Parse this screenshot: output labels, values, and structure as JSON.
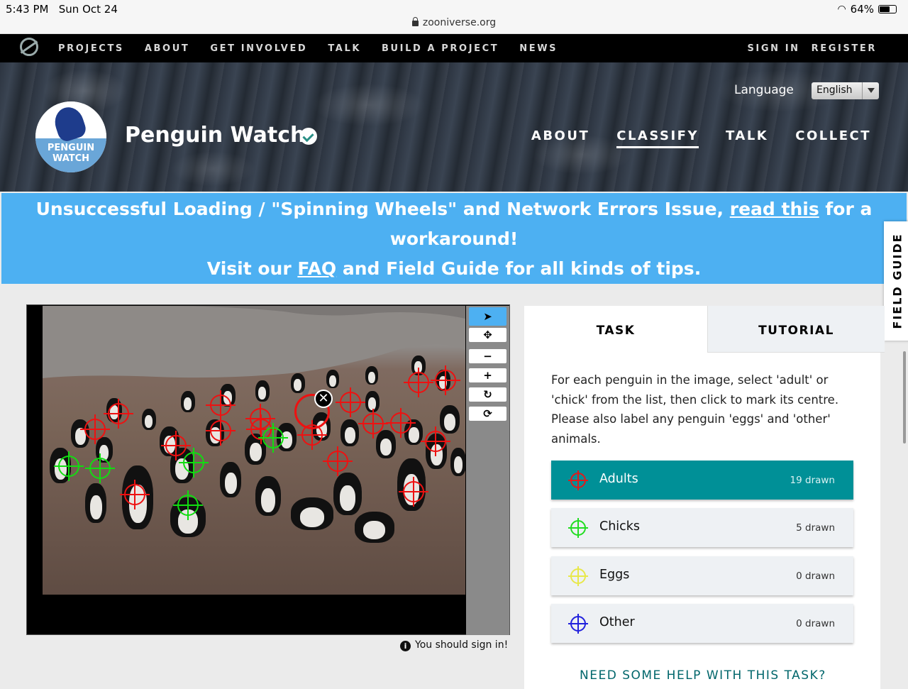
{
  "status_bar": {
    "time": "5:43 PM",
    "date": "Sun Oct 24",
    "url": "zooniverse.org",
    "battery": "64%"
  },
  "zoo_nav": {
    "items": [
      "PROJECTS",
      "ABOUT",
      "GET INVOLVED",
      "TALK",
      "BUILD A PROJECT",
      "NEWS"
    ],
    "sign_in": "SIGN IN",
    "register": "REGISTER"
  },
  "project": {
    "avatar_text_1": "PENGUIN",
    "avatar_text_2": "WATCH",
    "title": "Penguin Watch",
    "language_label": "Language",
    "language_value": "English",
    "nav": [
      "ABOUT",
      "CLASSIFY",
      "TALK",
      "COLLECT"
    ],
    "active_nav": "CLASSIFY"
  },
  "announcement": {
    "line1_pre": "Unsuccessful Loading / \"Spinning Wheels\" and Network Errors Issue, ",
    "line1_link": "read this",
    "line1_post": " for a",
    "line2": "workaround!",
    "line3_pre": "Visit our ",
    "line3_link": "FAQ",
    "line3_post": " and Field Guide for all kinds of tips."
  },
  "field_guide": "FIELD GUIDE",
  "viewer": {
    "tools": [
      "pointer-icon",
      "move-icon",
      "zoom-out-icon",
      "zoom-in-icon",
      "rotate-icon",
      "reset-icon"
    ],
    "tool_glyphs": [
      "➤",
      "✥",
      "−",
      "+",
      "↻",
      "⟳"
    ],
    "delete_glyph": "✕",
    "sign_in_note": "You should sign in!",
    "info_glyph": "i"
  },
  "task": {
    "tabs": [
      "TASK",
      "TUTORIAL"
    ],
    "instructions": "For each penguin in the image, select 'adult' or 'chick' from the list, then click to mark its centre. Please also label any penguin 'eggs' and 'other' animals.",
    "choices": [
      {
        "label": "Adults",
        "count": "19 drawn",
        "color": "#e11b1b",
        "selected": true
      },
      {
        "label": "Chicks",
        "count": "5 drawn",
        "color": "#22dd22",
        "selected": false
      },
      {
        "label": "Eggs",
        "count": "0 drawn",
        "color": "#e8e84a",
        "selected": false
      },
      {
        "label": "Other",
        "count": "0 drawn",
        "color": "#2222dd",
        "selected": false
      }
    ],
    "help_link": "NEED SOME HELP WITH THIS TASK?"
  }
}
